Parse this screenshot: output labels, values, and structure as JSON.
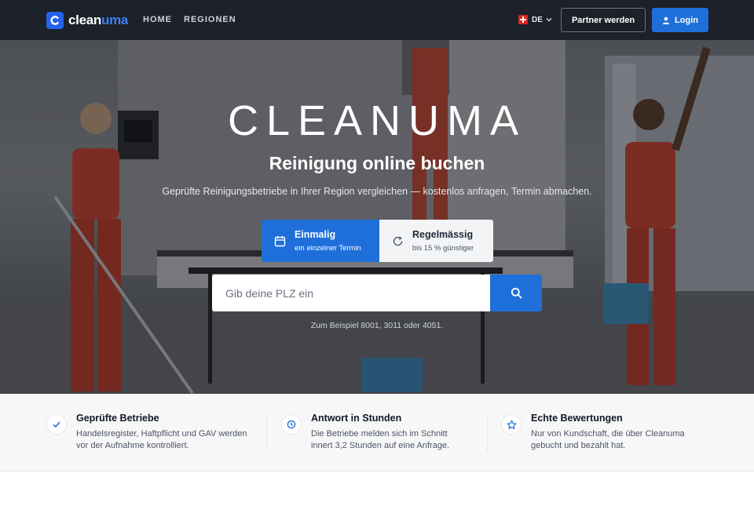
{
  "nav": {
    "logo_part1": "clean",
    "logo_part2": "uma",
    "links": [
      "HOME",
      "REGIONEN"
    ],
    "language": "DE",
    "partner_button": "Partner werden",
    "login_button": "Login"
  },
  "hero": {
    "title": "CLEANUMA",
    "subtitle": "Reinigung online buchen",
    "description": "Geprüfte Reinigungsbetriebe in Ihrer Region vergleichen — kostenlos anfragen, Termin abmachen.",
    "options": [
      {
        "label": "Einmalig",
        "hint": "ein einzelner Termin",
        "icon": "calendar-icon",
        "active": true
      },
      {
        "label": "Regelmässig",
        "hint": "bis 15 % günstiger",
        "icon": "refresh-icon",
        "active": false
      }
    ],
    "search_placeholder": "Gib deine PLZ ein",
    "example": "Zum Beispiel 8001, 3011 oder 4051."
  },
  "features": [
    {
      "icon": "check-icon",
      "title": "Geprüfte Betriebe",
      "desc_line1": "Handelsregister, Haftpflicht und GAV werden",
      "desc_line2": "vor der Aufnahme kontrolliert."
    },
    {
      "icon": "clock-icon",
      "title": "Antwort in Stunden",
      "desc_line1": "Die Betriebe melden sich im Schnitt",
      "desc_line2": "innert 3,2 Stunden auf eine Anfrage."
    },
    {
      "icon": "star-icon",
      "title": "Echte Bewertungen",
      "desc_line1": "Nur von Kundschaft, die über Cleanuma",
      "desc_line2": "gebucht und bezahlt hat."
    }
  ],
  "colors": {
    "accent": "#1e6fd9",
    "nav_bg": "#1d2129",
    "brand_light": "#3b82f6"
  }
}
